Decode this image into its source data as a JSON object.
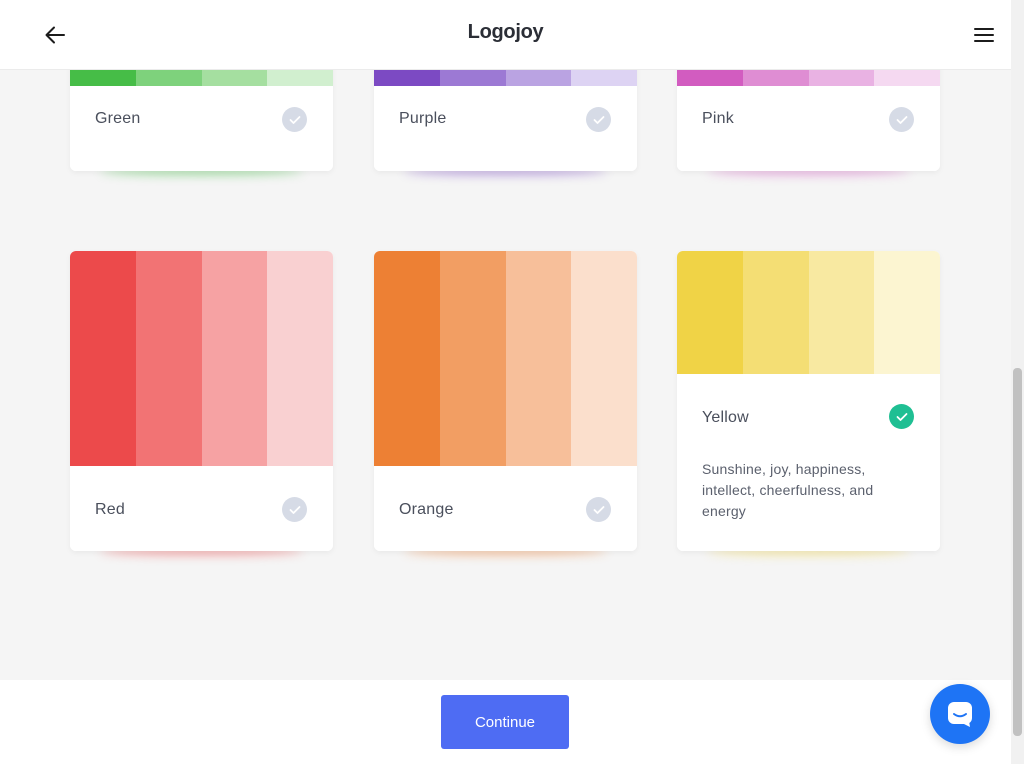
{
  "header": {
    "brand": "Logojoy",
    "back_icon": "arrow-left-icon",
    "menu_icon": "hamburger-menu-icon"
  },
  "colors": {
    "accent": "#4e6cf3",
    "selected_check": "#1fbf93",
    "unselected_check": "#d6dbe6",
    "chat": "#1e74f5"
  },
  "palettes": [
    {
      "name": "Green",
      "selected": false,
      "swatches": [
        "#46bd47",
        "#7ed27c",
        "#a5dfa0",
        "#d1efcf"
      ]
    },
    {
      "name": "Purple",
      "selected": false,
      "swatches": [
        "#7c4ac3",
        "#9c79d4",
        "#baa3e2",
        "#ddd3f3"
      ]
    },
    {
      "name": "Pink",
      "selected": false,
      "swatches": [
        "#d25cc0",
        "#df8dd3",
        "#e9b2e3",
        "#f5d9f1"
      ]
    },
    {
      "name": "Red",
      "selected": false,
      "swatches": [
        "#ec4a4b",
        "#f27374",
        "#f6a2a3",
        "#f9d0d1"
      ]
    },
    {
      "name": "Orange",
      "selected": false,
      "swatches": [
        "#ed8034",
        "#f29e63",
        "#f7bf9a",
        "#fbdfcc"
      ]
    },
    {
      "name": "Yellow",
      "selected": true,
      "swatches": [
        "#f0d346",
        "#f4de74",
        "#f8e9a1",
        "#fcf5d1"
      ],
      "description": "Sunshine, joy, happiness, intellect, cheerfulness, and energy"
    }
  ],
  "footer": {
    "continue_label": "Continue"
  },
  "chat": {
    "icon": "chat-bubble-icon"
  }
}
